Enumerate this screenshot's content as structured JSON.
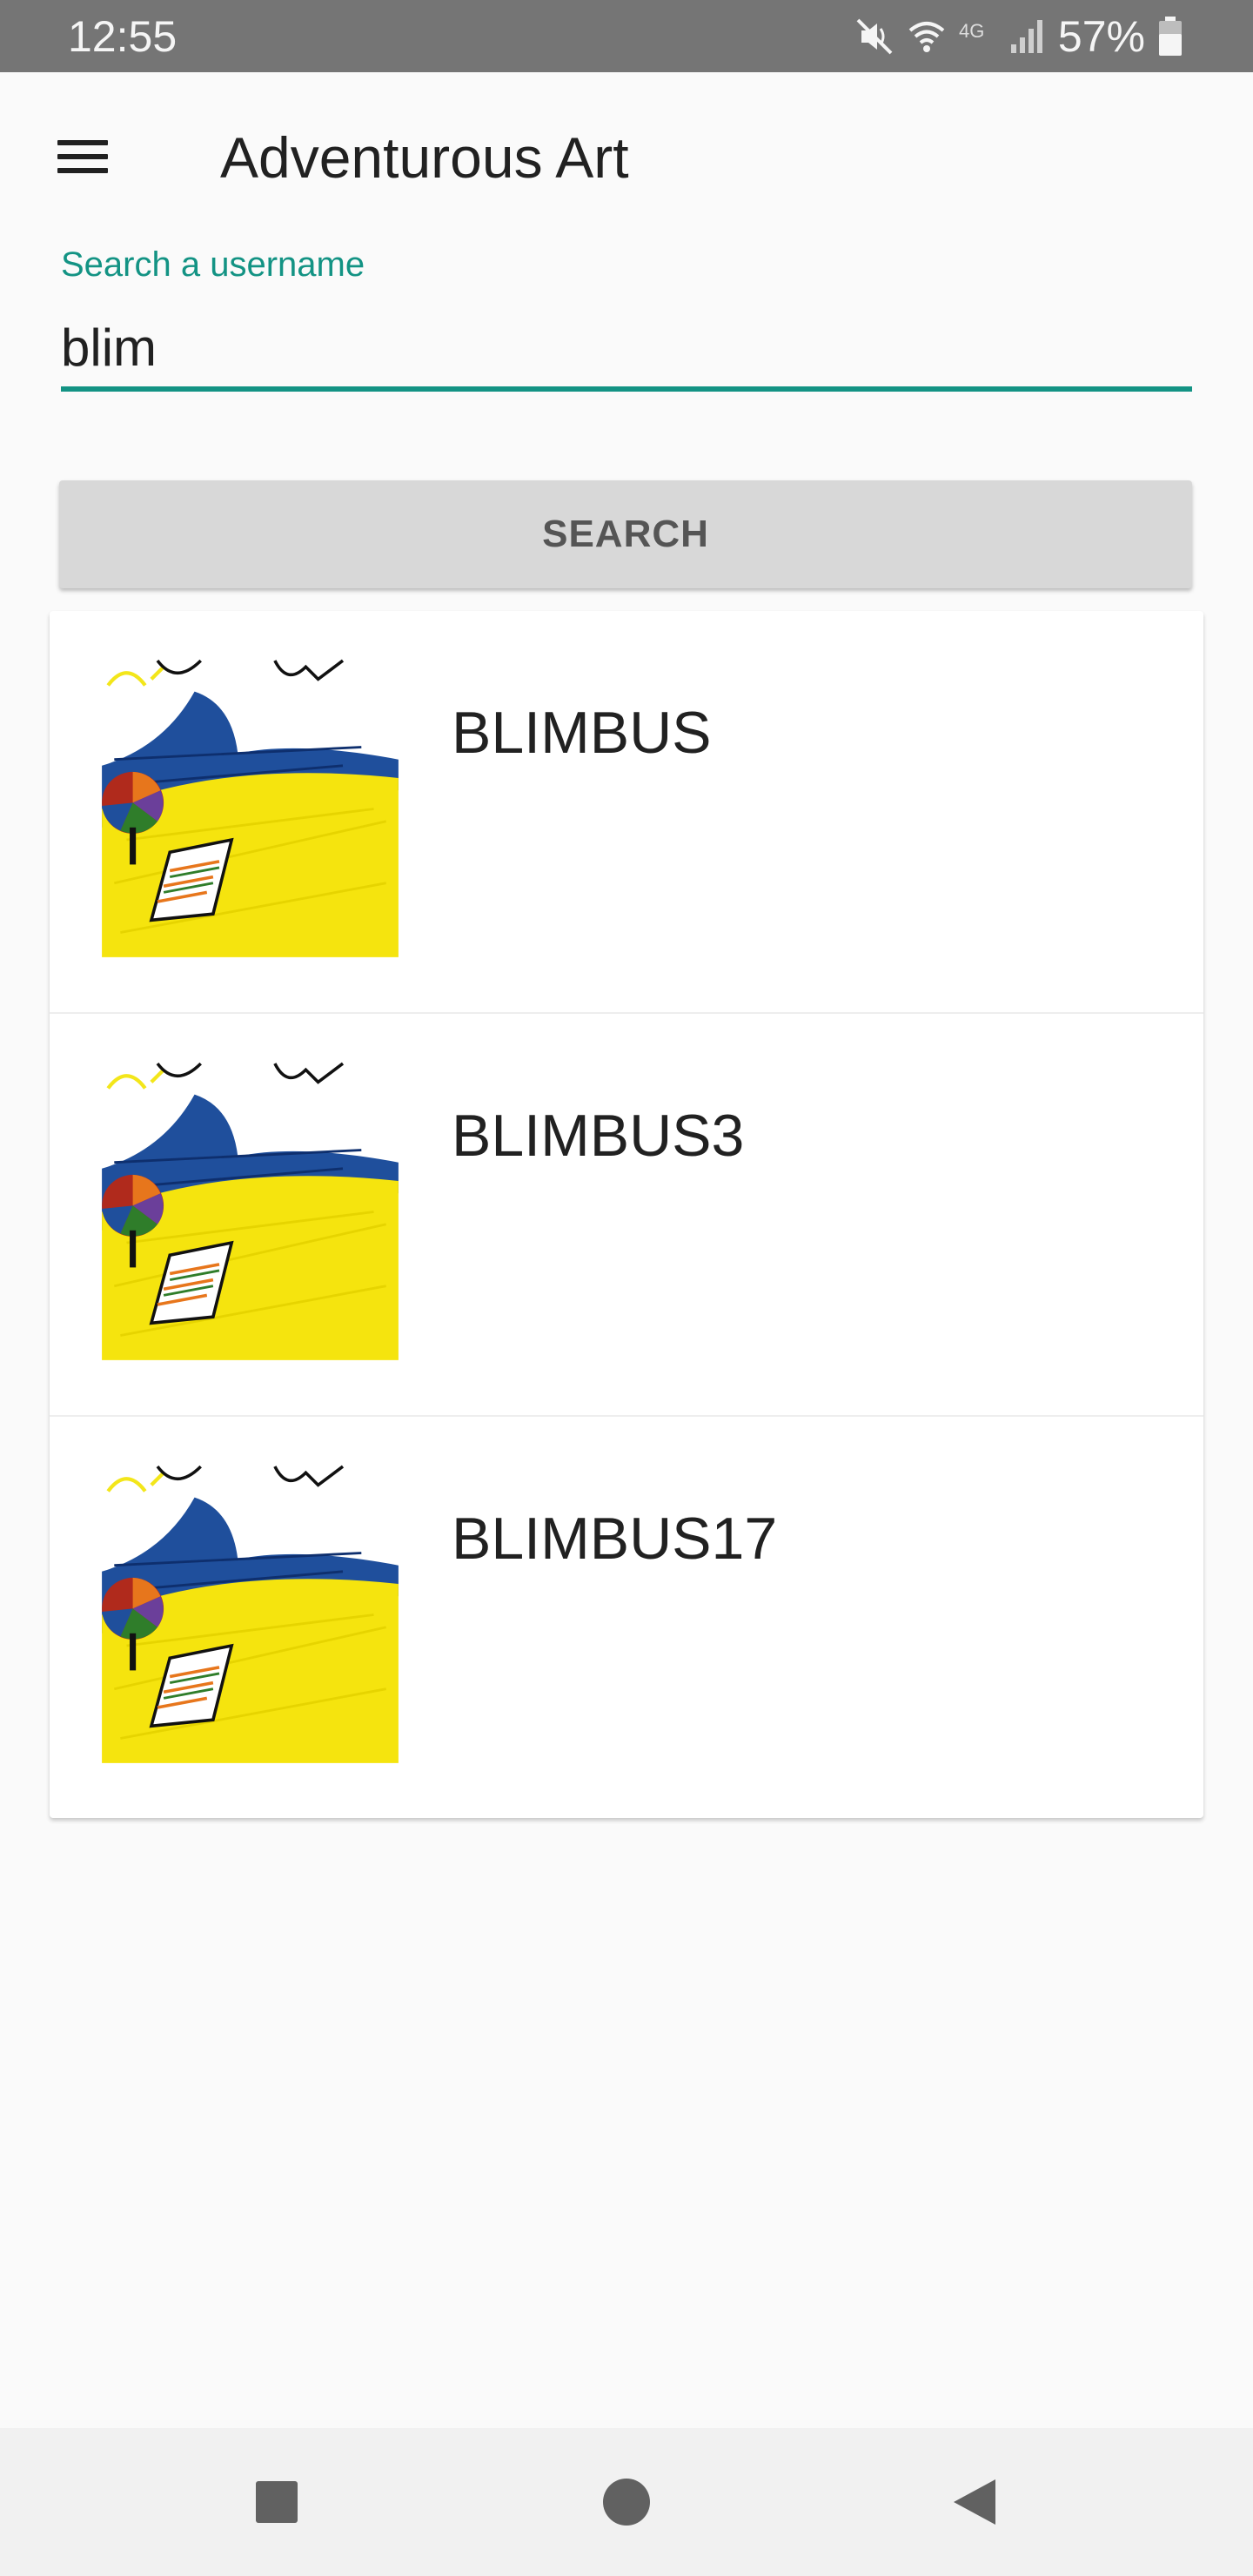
{
  "status_bar": {
    "time": "12:55",
    "battery_percent": "57%",
    "network_label": "4G",
    "icons": [
      "mute-icon",
      "wifi-icon",
      "signal-icon",
      "battery-icon"
    ]
  },
  "app_bar": {
    "title": "Adventurous Art",
    "menu_icon": "hamburger-menu-icon"
  },
  "search": {
    "label": "Search a username",
    "value": "blim",
    "button_label": "SEARCH"
  },
  "results": [
    {
      "username": "BLIMBUS"
    },
    {
      "username": "BLIMBUS3"
    },
    {
      "username": "BLIMBUS17"
    }
  ],
  "nav_bar": {
    "icons": [
      "recents-square-icon",
      "home-circle-icon",
      "back-triangle-icon"
    ]
  },
  "colors": {
    "accent": "#139384",
    "status_bar": "#757575",
    "background": "#fafafa",
    "button": "#d8d8d8",
    "drawing_sea": "#1f4f9c",
    "drawing_sand": "#f5e40e"
  }
}
